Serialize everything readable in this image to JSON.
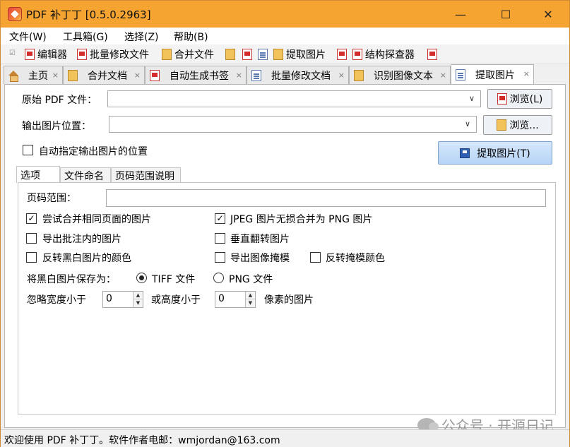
{
  "window": {
    "title": "PDF 补丁丁 [0.5.0.2963]",
    "minimize_glyph": "—",
    "maximize_glyph": "☐",
    "close_glyph": "✕"
  },
  "menu": [
    "文件(W)",
    "工具箱(G)",
    "选择(Z)",
    "帮助(B)"
  ],
  "toolbar": {
    "editor": "编辑器",
    "batch_modify": "批量修改文件",
    "merge": "合并文件",
    "extract_images": "提取图片",
    "structure_explorer": "结构探查器"
  },
  "tabs": [
    {
      "label": "主页",
      "icon": "home-icon"
    },
    {
      "label": "合并文档",
      "icon": "merge-icon"
    },
    {
      "label": "自动生成书签",
      "icon": "bookmark-icon"
    },
    {
      "label": "批量修改文档",
      "icon": "batch-icon"
    },
    {
      "label": "识别图像文本",
      "icon": "ocr-icon"
    },
    {
      "label": "提取图片",
      "icon": "extract-icon"
    }
  ],
  "tab_close_glyph": "×",
  "form": {
    "source_pdf_label": "原始 PDF 文件：",
    "source_pdf_value": "",
    "browse_pdf_button": "浏览(L)",
    "output_location_label": "输出图片位置：",
    "output_location_value": "",
    "browse_output_button": "浏览...",
    "auto_output_label": "自动指定输出图片的位置",
    "auto_output_checked": false,
    "extract_button": "提取图片(T)"
  },
  "inner_tabs": [
    "选项",
    "文件命名",
    "页码范围说明"
  ],
  "options": {
    "page_range_label": "页码范围：",
    "page_range_value": "",
    "merge_same_page": {
      "label": "尝试合并相同页面的图片",
      "checked": true
    },
    "jpeg_lossless_png": {
      "label": "JPEG 图片无损合并为 PNG 图片",
      "checked": true
    },
    "export_annotation": {
      "label": "导出批注内的图片",
      "checked": false
    },
    "vertical_flip": {
      "label": "垂直翻转图片",
      "checked": false
    },
    "invert_bw": {
      "label": "反转黑白图片的颜色",
      "checked": false
    },
    "export_mask": {
      "label": "导出图像掩模",
      "checked": false
    },
    "invert_mask": {
      "label": "反转掩模颜色",
      "checked": false
    },
    "save_bw_as_label": "将黑白图片保存为：",
    "tiff_label": "TIFF 文件",
    "png_label": "PNG 文件",
    "tiff_selected": true,
    "ignore_width_label": "忽略宽度小于",
    "ignore_width_value": "0",
    "or_height_label": "或高度小于",
    "ignore_height_value": "0",
    "pixels_suffix": "像素的图片"
  },
  "status": {
    "text": "欢迎使用 PDF 补丁丁。软件作者电邮：wmjordan@163.com"
  },
  "watermark": {
    "text": "公众号 · 开源日记"
  },
  "checkmark_glyph": "✓",
  "dropdown_glyph": "∨",
  "spin_up_glyph": "▲",
  "spin_down_glyph": "▼"
}
